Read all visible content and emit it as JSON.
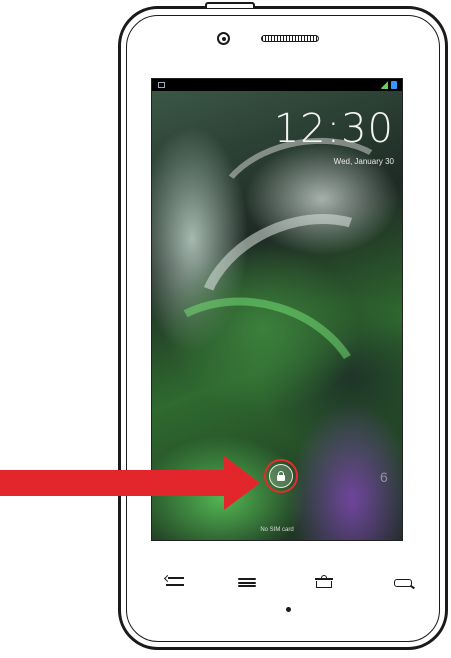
{
  "lockscreen": {
    "time": "12:30",
    "date": "Wed, January 30",
    "sim_status": "No SIM card",
    "camera_shortcut_glyph": "6"
  },
  "icons": {
    "status_notification": "image-notification-icon",
    "status_signal": "signal-icon",
    "status_battery": "battery-icon",
    "unlock": "lock-icon",
    "nav_back": "back-icon",
    "nav_menu": "menu-icon",
    "nav_home": "home-icon",
    "nav_search": "search-icon"
  },
  "colors": {
    "arrow": "#e3262b",
    "highlight_ring": "#e82a2a",
    "battery": "#3399ff",
    "signal": "#66cc66"
  }
}
